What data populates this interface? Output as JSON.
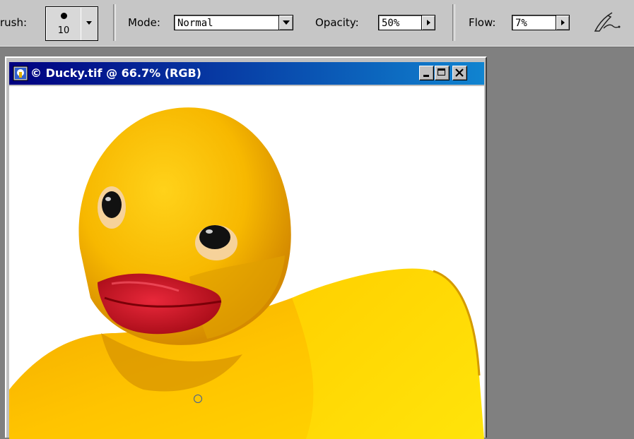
{
  "options_bar": {
    "brush_label": "rush:",
    "brush_size": "10",
    "mode_label": "Mode:",
    "mode_value": "Normal",
    "opacity_label": "Opacity:",
    "opacity_value": "50%",
    "flow_label": "Flow:",
    "flow_value": "7%",
    "airbrush_icon": "airbrush-icon"
  },
  "document": {
    "title": "© Ducky.tif @ 66.7% (RGB)",
    "icon": "photoshop-document-icon",
    "buttons": [
      "minimize-icon",
      "maximize-icon",
      "close-icon"
    ]
  },
  "colors": {
    "title_start": "#000080",
    "title_end": "#1084d0",
    "duck_yellow": "#f8c000",
    "beak_red": "#cc1020"
  }
}
